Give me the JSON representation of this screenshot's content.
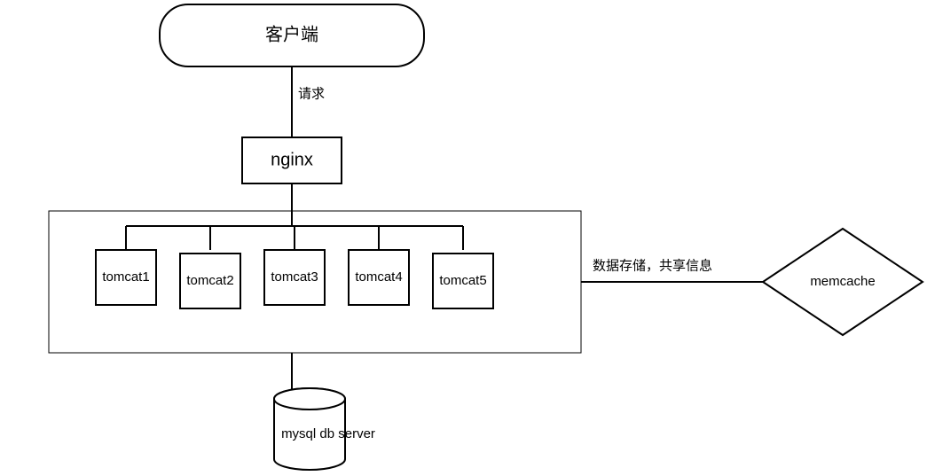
{
  "nodes": {
    "client": "客户端",
    "nginx": "nginx",
    "tomcat1": "tomcat1",
    "tomcat2": "tomcat2",
    "tomcat3": "tomcat3",
    "tomcat4": "tomcat4",
    "tomcat5": "tomcat5",
    "db": "mysql db  server",
    "memcache": "memcache"
  },
  "edges": {
    "request": "请求",
    "storage": "数据存储，共享信息"
  }
}
